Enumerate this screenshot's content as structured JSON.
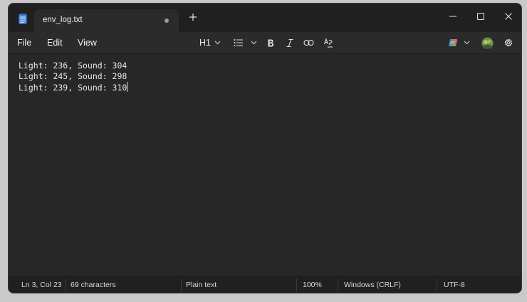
{
  "window": {
    "tab_title": "env_log.txt",
    "accent": "#4c8ee6"
  },
  "menu": {
    "file": "File",
    "edit": "Edit",
    "view": "View"
  },
  "toolbar": {
    "heading": "H1"
  },
  "editor": {
    "lines": [
      "Light: 236, Sound: 304",
      "Light: 245, Sound: 298",
      "Light: 239, Sound: 310"
    ]
  },
  "status": {
    "position": "Ln 3, Col 23",
    "characters": "69 characters",
    "format": "Plain text",
    "zoom": "100%",
    "line_ending": "Windows (CRLF)",
    "encoding": "UTF-8"
  },
  "icons": {
    "app": "notepad-icon",
    "new_tab": "plus-icon",
    "minimize": "minimize-icon",
    "maximize": "maximize-icon",
    "close": "close-icon",
    "list": "list-icon",
    "bold": "bold-icon",
    "italic": "italic-icon",
    "link": "link-icon",
    "clear_format": "clear-format-icon",
    "copilot": "copilot-icon",
    "avatar": "profile-avatar-icon",
    "settings": "gear-icon"
  }
}
